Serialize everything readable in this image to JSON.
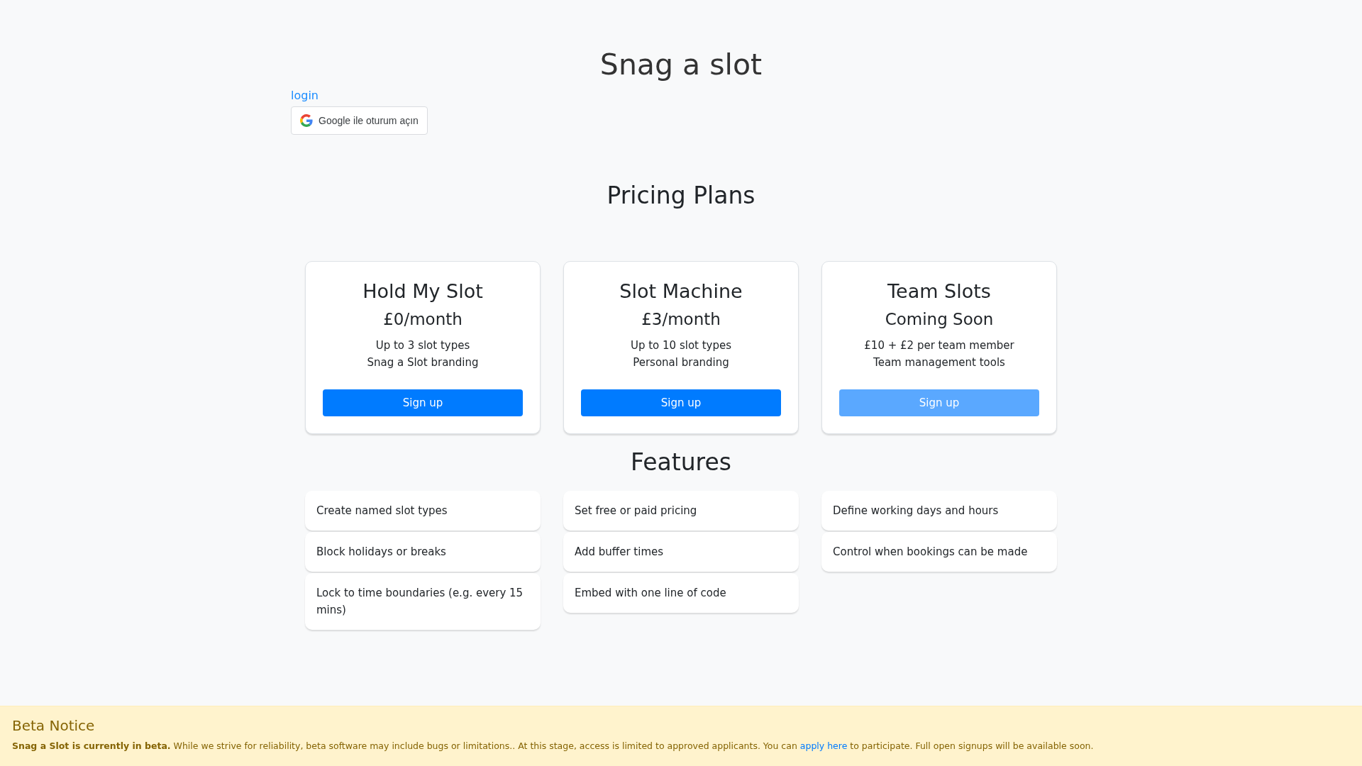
{
  "header": {
    "title": "Snag a slot",
    "login_link": "login",
    "google_button": "Google ile oturum açın"
  },
  "pricing": {
    "heading": "Pricing Plans",
    "plans": [
      {
        "name": "Hold My Slot",
        "price": "£0/month",
        "features": [
          "Up to 3 slot types",
          "Snag a Slot branding"
        ],
        "button": "Sign up",
        "disabled": false
      },
      {
        "name": "Slot Machine",
        "price": "£3/month",
        "features": [
          "Up to 10 slot types",
          "Personal branding"
        ],
        "button": "Sign up",
        "disabled": false
      },
      {
        "name": "Team Slots",
        "price": "Coming Soon",
        "features": [
          "£10 + £2 per team member",
          "Team management tools"
        ],
        "button": "Sign up",
        "disabled": true
      }
    ]
  },
  "features": {
    "heading": "Features",
    "columns": [
      [
        "Create named slot types",
        "Block holidays or breaks",
        "Lock to time boundaries (e.g. every 15 mins)"
      ],
      [
        "Set free or paid pricing",
        "Add buffer times",
        "Embed with one line of code"
      ],
      [
        "Define working days and hours",
        "Control when bookings can be made"
      ]
    ]
  },
  "beta_notice": {
    "title": "Beta Notice",
    "text_before": "**Snag a Slot is currently in beta.** While we strive for reliability, beta software may include bugs or limitations.. At this stage, access is limited to approved applicants. You can ",
    "link": "apply here",
    "text_after": " to participate. Full open signups will be available soon."
  }
}
